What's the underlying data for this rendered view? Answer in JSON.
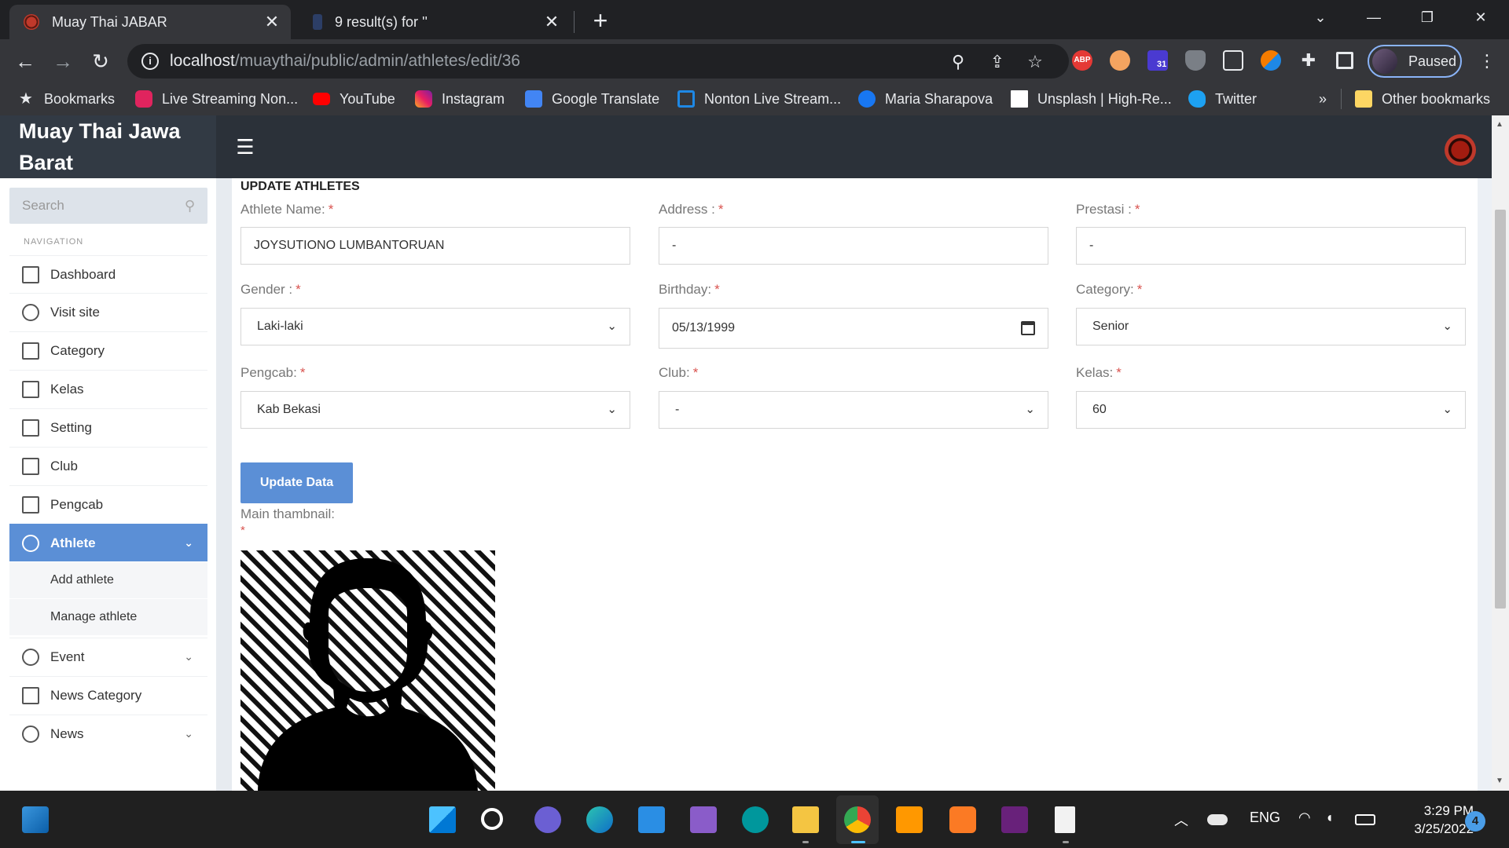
{
  "browser": {
    "tabs": [
      {
        "title": "Muay Thai JABAR",
        "active": true
      },
      {
        "title": "9 result(s) for ''",
        "active": false
      }
    ],
    "url_host": "localhost",
    "url_path": "/muaythai/public/admin/athletes/edit/36",
    "profile_label": "Paused",
    "ext_badge": "31",
    "abp_label": "ABP",
    "bookmarks": [
      "Bookmarks",
      "Live Streaming Non...",
      "YouTube",
      "Instagram",
      "Google Translate",
      "Nonton Live Stream...",
      "Maria Sharapova",
      "Unsplash | High-Re...",
      "Twitter"
    ],
    "bookmarks_more": "»",
    "other_bookmarks": "Other bookmarks"
  },
  "app": {
    "brand_line1": "Muay Thai Jawa",
    "brand_line2": "Barat"
  },
  "sidebar": {
    "search_placeholder": "Search",
    "nav_header": "NAVIGATION",
    "items": [
      {
        "label": "Dashboard"
      },
      {
        "label": "Visit site"
      },
      {
        "label": "Category"
      },
      {
        "label": "Kelas"
      },
      {
        "label": "Setting"
      },
      {
        "label": "Club"
      },
      {
        "label": "Pengcab"
      },
      {
        "label": "Athlete"
      },
      {
        "label": "Event"
      },
      {
        "label": "News Category"
      },
      {
        "label": "News"
      }
    ],
    "athlete_subitems": [
      "Add athlete",
      "Manage athlete"
    ]
  },
  "form": {
    "title": "UPDATE ATHLETES",
    "required_mark": "*",
    "fields": {
      "athlete_name": {
        "label": "Athlete Name:",
        "value": "JOYSUTIONO LUMBANTORUAN"
      },
      "address": {
        "label": "Address :",
        "value": "-"
      },
      "prestasi": {
        "label": "Prestasi :",
        "value": "-"
      },
      "gender": {
        "label": "Gender :",
        "value": "Laki-laki"
      },
      "birthday": {
        "label": "Birthday:",
        "value": "05/13/1999"
      },
      "category": {
        "label": "Category:",
        "value": "Senior"
      },
      "pengcab": {
        "label": "Pengcab:",
        "value": "Kab Bekasi"
      },
      "club": {
        "label": "Club:",
        "value": "-"
      },
      "kelas": {
        "label": "Kelas:",
        "value": "60"
      }
    },
    "submit_label": "Update Data",
    "thumbnail_label": "Main thambnail:"
  },
  "taskbar": {
    "lang": "ENG",
    "time": "3:29 PM",
    "date": "3/25/2022",
    "notifications": "4"
  }
}
